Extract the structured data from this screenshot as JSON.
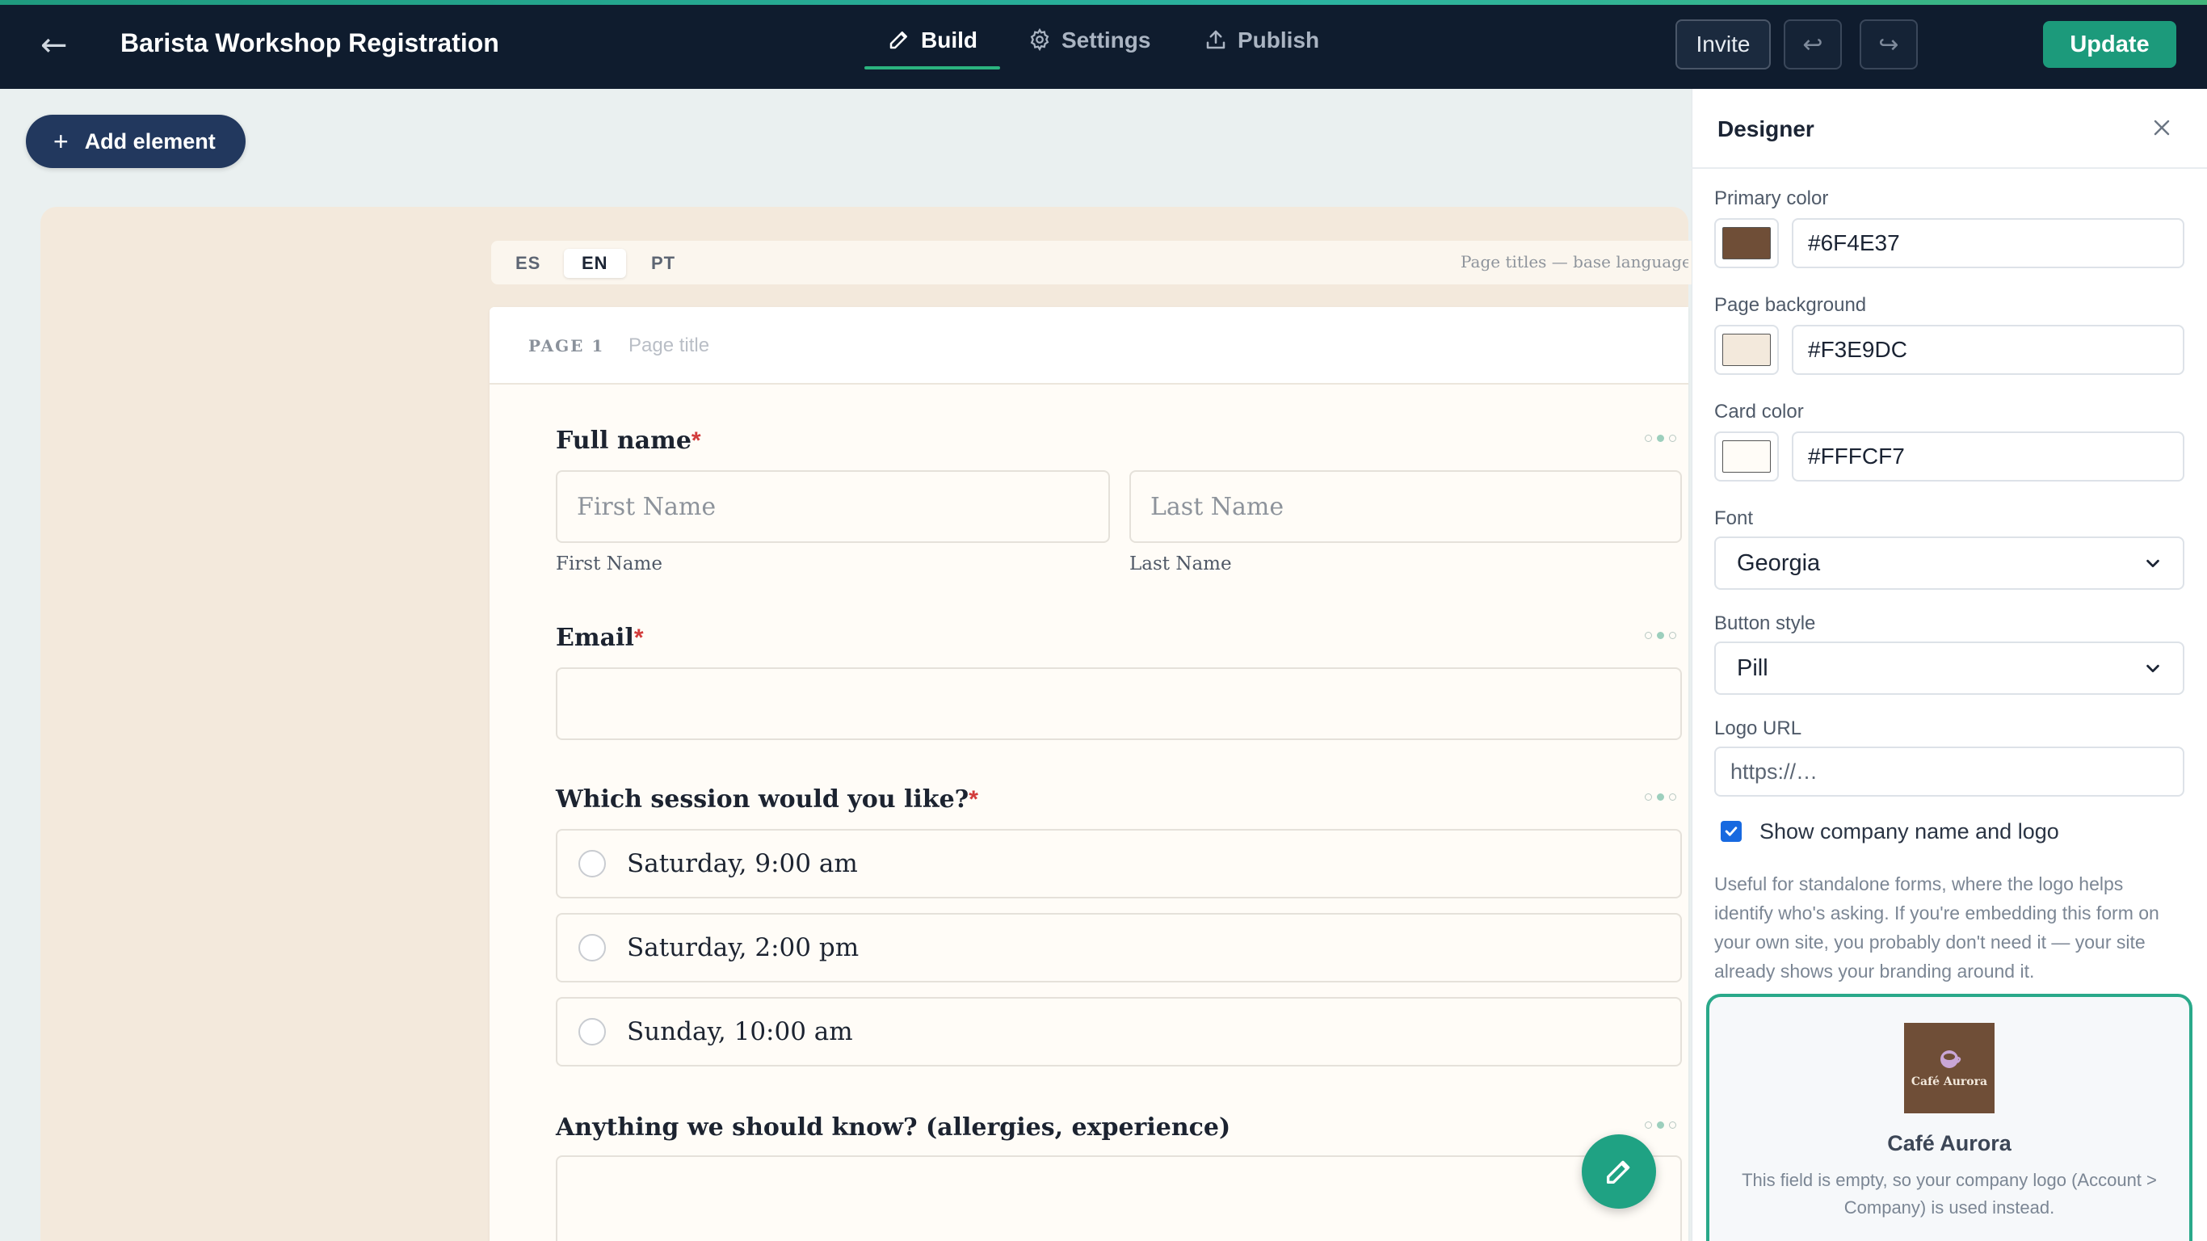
{
  "header": {
    "back_icon": "arrow-left-icon",
    "title": "Barista Workshop Registration",
    "tabs": [
      {
        "label": "Build",
        "icon": "pencil-icon",
        "active": true
      },
      {
        "label": "Settings",
        "icon": "gear-icon",
        "active": false
      },
      {
        "label": "Publish",
        "icon": "upload-icon",
        "active": false
      }
    ],
    "invite_label": "Invite",
    "undo_icon": "undo-icon",
    "redo_icon": "redo-icon",
    "update_label": "Update"
  },
  "toolbar": {
    "add_element_label": "Add element"
  },
  "languages": {
    "options": [
      "ES",
      "EN",
      "PT"
    ],
    "selected": "EN",
    "note": "Page titles — base language: E"
  },
  "page": {
    "label": "PAGE 1",
    "title_placeholder": "Page title",
    "questions": {
      "full_name": {
        "label": "Full name",
        "required": "*",
        "first_placeholder": "First Name",
        "last_placeholder": "Last Name",
        "first_sublabel": "First Name",
        "last_sublabel": "Last Name"
      },
      "email": {
        "label": "Email",
        "required": "*",
        "value": ""
      },
      "session": {
        "label": "Which session would you like?",
        "required": "*",
        "options": [
          "Saturday, 9:00 am",
          "Saturday, 2:00 pm",
          "Sunday, 10:00 am"
        ]
      },
      "notes": {
        "label": "Anything we should know? (allergies, experience)"
      }
    }
  },
  "designer": {
    "title": "Designer",
    "primary_color_label": "Primary color",
    "primary_color": "#6F4E37",
    "page_background_label": "Page background",
    "page_background": "#F3E9DC",
    "card_color_label": "Card color",
    "card_color": "#FFFCF7",
    "font_label": "Font",
    "font_value": "Georgia",
    "button_style_label": "Button style",
    "button_style_value": "Pill",
    "logo_url_label": "Logo URL",
    "logo_url_placeholder": "https://…",
    "show_company_label": "Show company name and logo",
    "show_company_checked": true,
    "help_text": "Useful for standalone forms, where the logo helps identify who's asking. If you're embedding this form on your own site, you probably don't need it — your site already shows your branding around it.",
    "preview": {
      "logo_text": "Café Aurora",
      "company_name": "Café Aurora",
      "note": "This field is empty, so your company logo (Account > Company) is used instead."
    }
  },
  "colors": {
    "topbar": "#0F1C2E",
    "accent": "#1C9A7B",
    "add_button": "#22385E",
    "required": "#D23B3B"
  }
}
